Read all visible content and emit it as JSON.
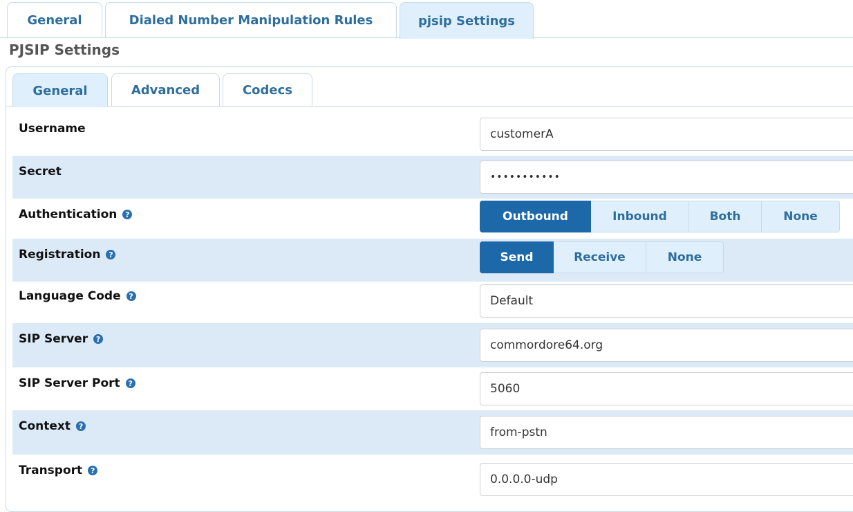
{
  "top_tabs": [
    {
      "label": "General",
      "active": false
    },
    {
      "label": "Dialed Number Manipulation Rules",
      "active": false
    },
    {
      "label": "pjsip Settings",
      "active": true
    }
  ],
  "section_title": "PJSIP Settings",
  "sub_tabs": [
    {
      "label": "General",
      "active": true
    },
    {
      "label": "Advanced",
      "active": false
    },
    {
      "label": "Codecs",
      "active": false
    }
  ],
  "fields": {
    "username": {
      "label": "Username",
      "value": "customerA"
    },
    "secret": {
      "label": "Secret",
      "value": "•••••••••••"
    },
    "authentication": {
      "label": "Authentication",
      "options": [
        "Outbound",
        "Inbound",
        "Both",
        "None"
      ],
      "selected": "Outbound"
    },
    "registration": {
      "label": "Registration",
      "options": [
        "Send",
        "Receive",
        "None"
      ],
      "selected": "Send"
    },
    "language_code": {
      "label": "Language Code",
      "value": "Default"
    },
    "sip_server": {
      "label": "SIP Server",
      "value": "commordore64.org"
    },
    "sip_server_port": {
      "label": "SIP Server Port",
      "value": "5060"
    },
    "context": {
      "label": "Context",
      "value": "from-pstn"
    },
    "transport": {
      "label": "Transport",
      "value": "0.0.0.0-udp"
    }
  },
  "help_icon_glyph": "?",
  "colors": {
    "accent": "#1c68a8",
    "tab_text": "#2e6e9e",
    "row_alt": "#dceaf8",
    "border": "#c5dbec"
  }
}
